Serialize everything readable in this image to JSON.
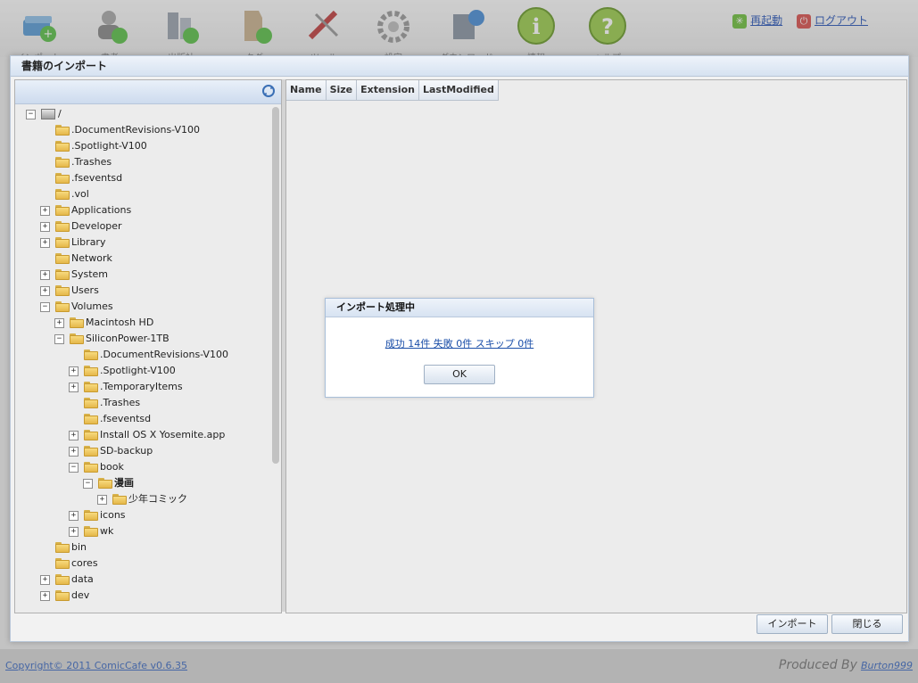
{
  "toolbar": {
    "items": [
      {
        "label": "インポート",
        "icon": "import-book-icon"
      },
      {
        "label": "書者",
        "icon": "author-icon"
      },
      {
        "label": "出版社",
        "icon": "publisher-icon"
      },
      {
        "label": "タグ",
        "icon": "tag-icon"
      },
      {
        "label": "ツール",
        "icon": "tools-icon"
      },
      {
        "label": "設定",
        "icon": "settings-gear-icon"
      },
      {
        "label": "ダウンロード",
        "icon": "download-icon"
      },
      {
        "label": "情報",
        "icon": "info-icon"
      },
      {
        "label": "ヘルプ",
        "icon": "help-icon"
      }
    ],
    "restart_label": "再起動",
    "logout_label": "ログアウト"
  },
  "dialog": {
    "title": "書籍のインポート",
    "columns": [
      "Name",
      "Size",
      "Extension",
      "LastModified"
    ],
    "import_button": "インポート",
    "close_button": "閉じる"
  },
  "tree": [
    {
      "label": "/",
      "toggle": "−",
      "drive": true
    },
    {
      "label": ".DocumentRevisions-V100",
      "toggle": ""
    },
    {
      "label": ".Spotlight-V100",
      "toggle": ""
    },
    {
      "label": ".Trashes",
      "toggle": ""
    },
    {
      "label": ".fseventsd",
      "toggle": ""
    },
    {
      "label": ".vol",
      "toggle": ""
    },
    {
      "label": "Applications",
      "toggle": "+"
    },
    {
      "label": "Developer",
      "toggle": "+"
    },
    {
      "label": "Library",
      "toggle": "+"
    },
    {
      "label": "Network",
      "toggle": ""
    },
    {
      "label": "System",
      "toggle": "+"
    },
    {
      "label": "Users",
      "toggle": "+"
    },
    {
      "label": "Volumes",
      "toggle": "−"
    },
    {
      "label": "Macintosh HD",
      "toggle": "+"
    },
    {
      "label": "SiliconPower-1TB",
      "toggle": "−"
    },
    {
      "label": ".DocumentRevisions-V100",
      "toggle": ""
    },
    {
      "label": ".Spotlight-V100",
      "toggle": "+"
    },
    {
      "label": ".TemporaryItems",
      "toggle": "+"
    },
    {
      "label": ".Trashes",
      "toggle": ""
    },
    {
      "label": ".fseventsd",
      "toggle": ""
    },
    {
      "label": "Install OS X Yosemite.app",
      "toggle": "+"
    },
    {
      "label": "SD-backup",
      "toggle": "+"
    },
    {
      "label": "book",
      "toggle": "−"
    },
    {
      "label": "漫画",
      "toggle": "−",
      "bold": true
    },
    {
      "label": "少年コミック",
      "toggle": "+"
    },
    {
      "label": "icons",
      "toggle": "+"
    },
    {
      "label": "wk",
      "toggle": "+"
    },
    {
      "label": "bin",
      "toggle": ""
    },
    {
      "label": "cores",
      "toggle": ""
    },
    {
      "label": "data",
      "toggle": "+"
    },
    {
      "label": "dev",
      "toggle": "+"
    }
  ],
  "modal": {
    "title": "インポート処理中",
    "message": "成功 14件 失敗 0件 スキップ 0件",
    "ok_label": "OK"
  },
  "footer": {
    "copyright": "Copyright© 2011 ComicCafe v0.6.35",
    "produced_by": "Produced By",
    "author": "Burton999"
  }
}
